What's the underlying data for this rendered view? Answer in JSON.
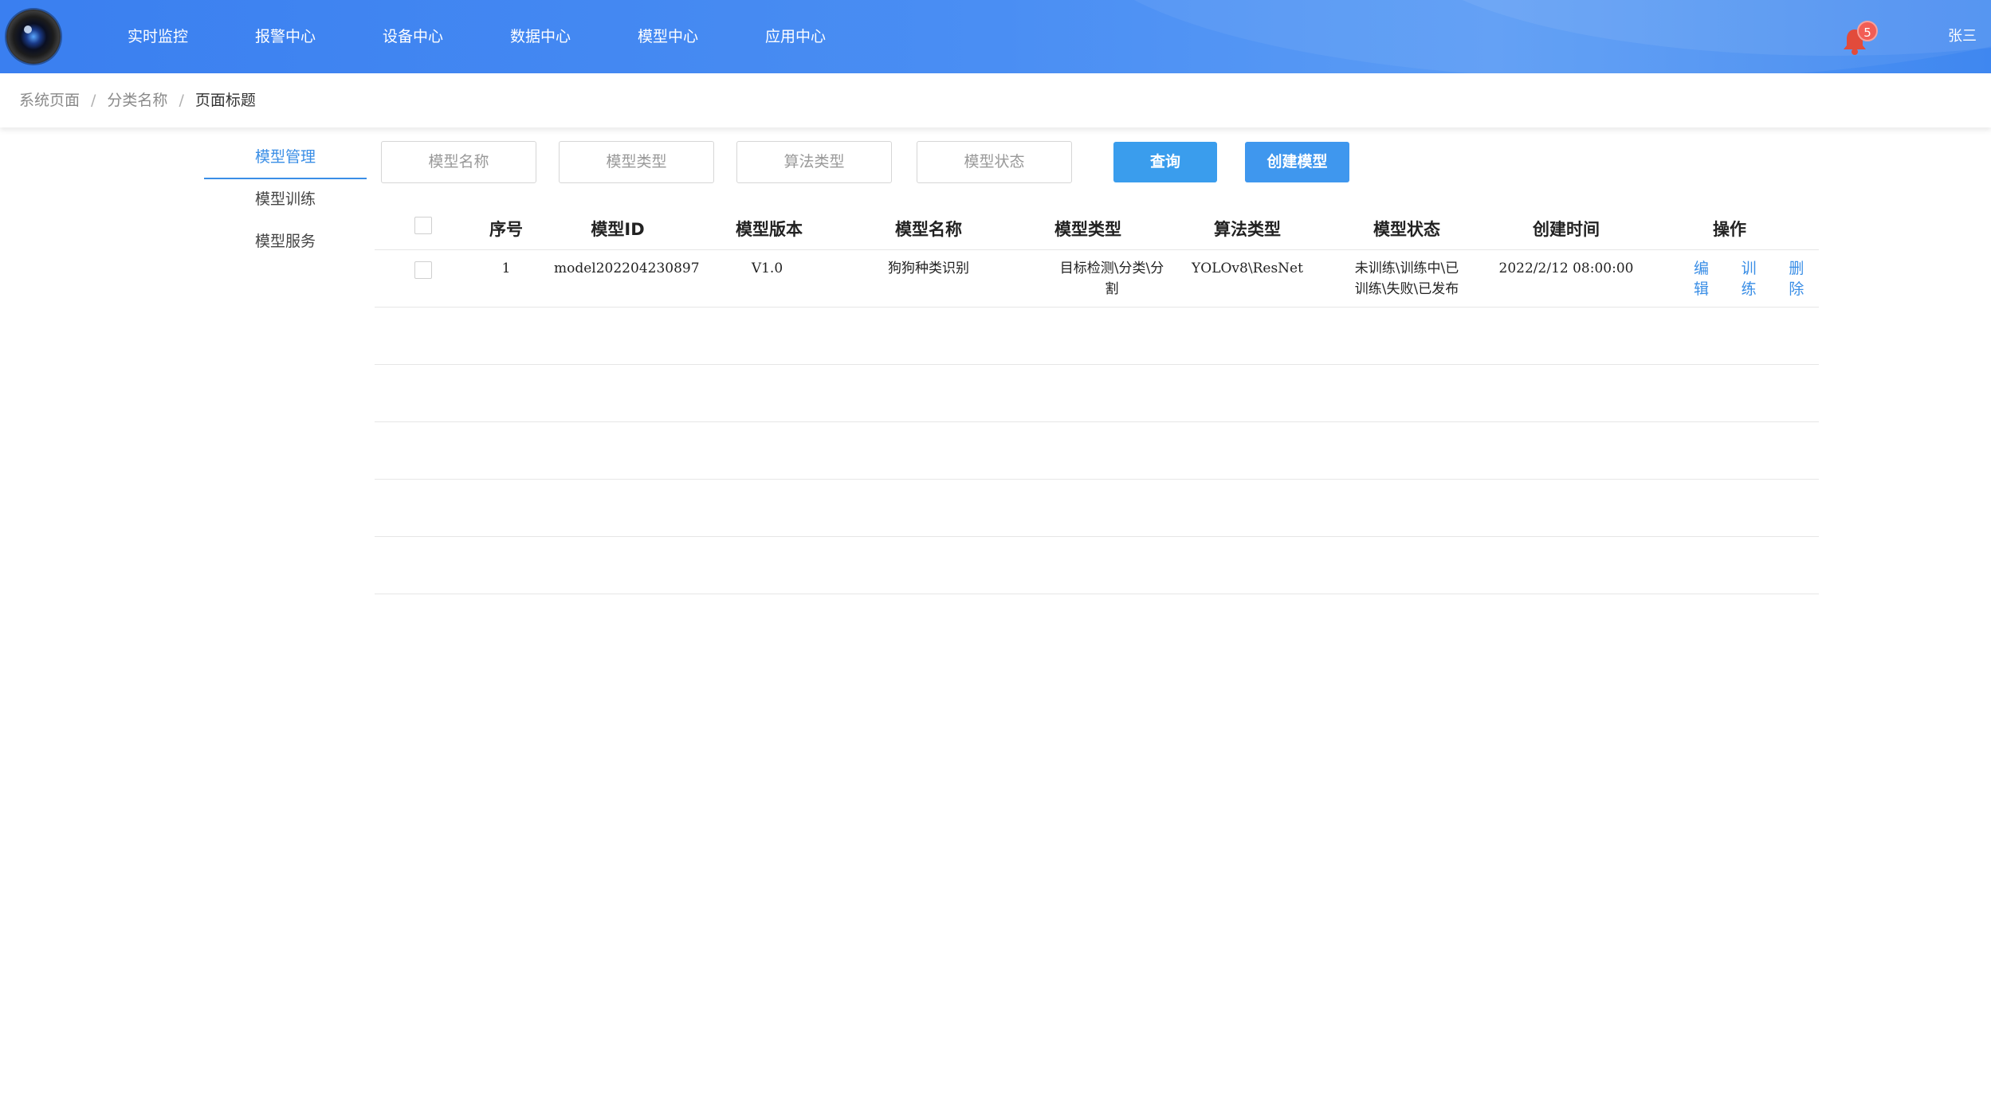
{
  "nav": {
    "items": [
      "实时监控",
      "报警中心",
      "设备中心",
      "数据中心",
      "模型中心",
      "应用中心"
    ]
  },
  "notifications": {
    "count": "5"
  },
  "user": {
    "name": "张三"
  },
  "breadcrumb": {
    "items": [
      "系统页面",
      "分类名称",
      "页面标题"
    ],
    "separator": "/"
  },
  "side_menu": {
    "items": [
      "模型管理",
      "模型训练",
      "模型服务"
    ],
    "active": "模型管理"
  },
  "filters": {
    "model_name_placeholder": "模型名称",
    "model_type_placeholder": "模型类型",
    "algo_type_placeholder": "算法类型",
    "model_status_placeholder": "模型状态"
  },
  "buttons": {
    "query": "查询",
    "create": "创建模型"
  },
  "table": {
    "headers": [
      "序号",
      "模型ID",
      "模型版本",
      "模型名称",
      "模型类型",
      "算法类型",
      "模型状态",
      "创建时间",
      "操作"
    ],
    "rows": [
      {
        "index": "1",
        "id": "model202204230897",
        "version": "V1.0",
        "name": "狗狗种类识别",
        "type_line1": "目标检测\\分类\\分",
        "type_line2": "割",
        "algo": "YOLOv8\\ResNet",
        "status_line1": "未训练\\训练中\\已",
        "status_line2": "训练\\失败\\已发布",
        "created": "2022/2/12 08:00:00",
        "ops": [
          "编辑",
          "训练",
          "删除"
        ]
      }
    ]
  },
  "colors": {
    "header": "#3a7ff0",
    "accent": "#3a8ee6",
    "badge": "#f25d55",
    "bell": "#e24b3b"
  }
}
